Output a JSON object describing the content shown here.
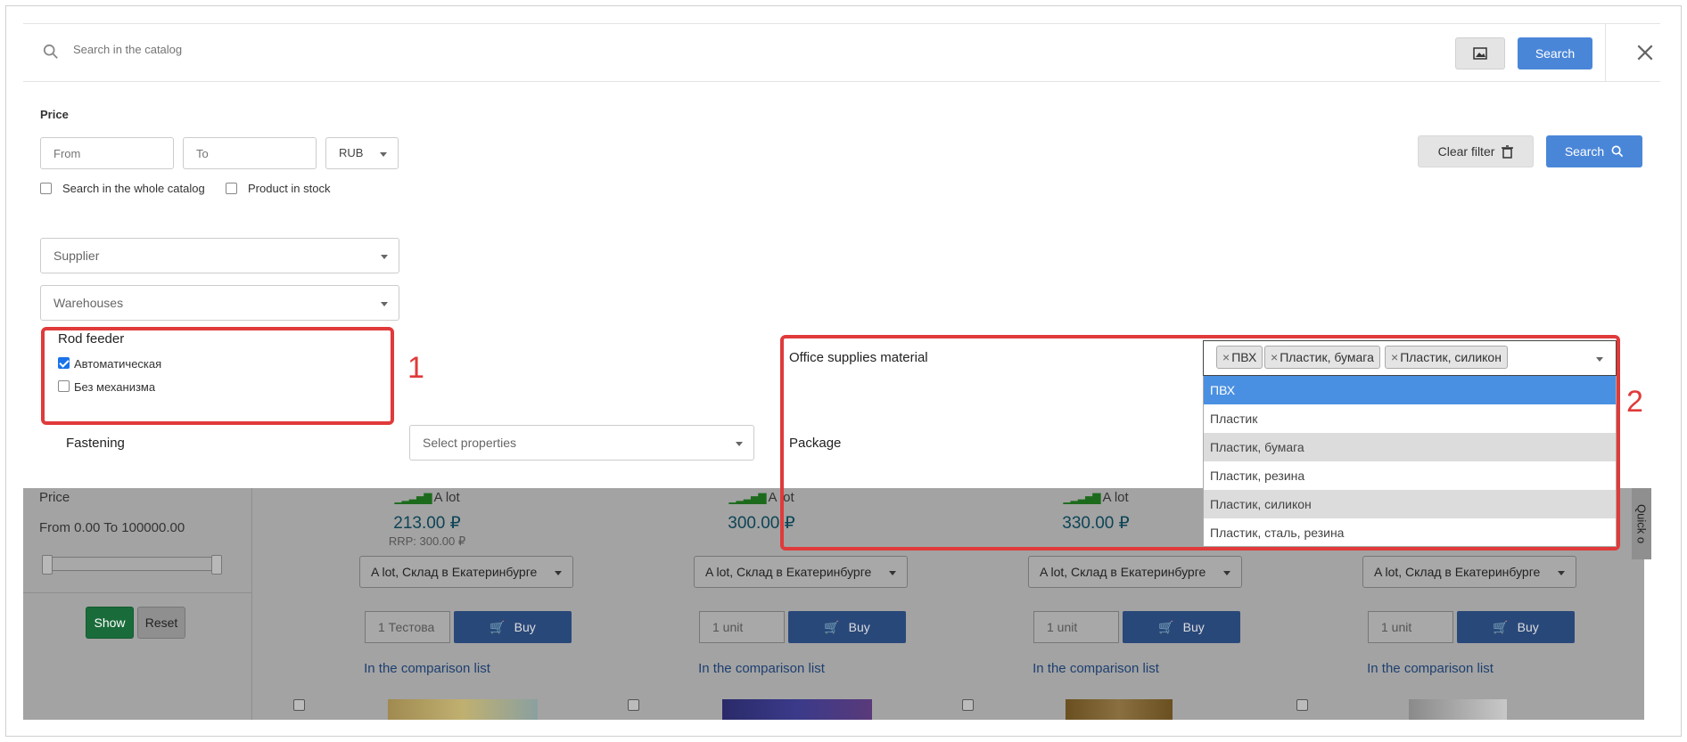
{
  "colors": {
    "primary": "#4a86d8",
    "annotation": "#e03a3a",
    "highlight_option": "#4a90e2"
  },
  "search": {
    "placeholder": "Search in the catalog",
    "button_label": "Search"
  },
  "filters": {
    "price_label": "Price",
    "from_placeholder": "From",
    "to_placeholder": "To",
    "currency": "RUB",
    "whole_catalog_label": "Search in the whole catalog",
    "whole_catalog_checked": false,
    "in_stock_label": "Product in stock",
    "in_stock_checked": false,
    "clear_label": "Clear filter",
    "search_label": "Search",
    "supplier_placeholder": "Supplier",
    "warehouses_placeholder": "Warehouses",
    "rod_feeder": {
      "title": "Rod feeder",
      "options": [
        {
          "label": "Автоматическая",
          "checked": true
        },
        {
          "label": "Без механизма",
          "checked": false
        }
      ]
    },
    "fastening_label": "Fastening",
    "fastening_placeholder": "Select properties",
    "office_material": {
      "label": "Office supplies material",
      "selected_tags": [
        "ПВХ",
        "Пластик, бумага",
        "Пластик, силикон"
      ],
      "options": [
        {
          "label": "ПВХ",
          "state": "active"
        },
        {
          "label": "Пластик",
          "state": "normal"
        },
        {
          "label": "Пластик, бумага",
          "state": "selected"
        },
        {
          "label": "Пластик, резина",
          "state": "normal"
        },
        {
          "label": "Пластик, силикон",
          "state": "selected"
        },
        {
          "label": "Пластик, сталь, резина",
          "state": "normal"
        }
      ]
    },
    "package_label": "Package"
  },
  "annotations": {
    "first": "1",
    "second": "2"
  },
  "background_catalog": {
    "sidebar": {
      "price_label": "Price",
      "range_text": "From 0.00 To 100000.00",
      "show_label": "Show",
      "reset_label": "Reset"
    },
    "products": [
      {
        "availability": "A lot",
        "price": "213.00 ₽",
        "rrp": "RRP: 300.00 ₽",
        "stock": "A lot, Склад в Екатеринбурге",
        "qty": "1 Тестова",
        "buy": "Buy",
        "compare": "In the comparison list"
      },
      {
        "availability": "A lot",
        "price": "300.00 ₽",
        "rrp": "",
        "stock": "A lot, Склад в Екатеринбурге",
        "qty": "1 unit",
        "buy": "Buy",
        "compare": "In the comparison list"
      },
      {
        "availability": "A lot",
        "price": "330.00 ₽",
        "rrp": "",
        "stock": "A lot, Склад в Екатеринбурге",
        "qty": "1 unit",
        "buy": "Buy",
        "compare": "In the comparison list"
      },
      {
        "availability": "",
        "price": "",
        "rrp": "",
        "stock": "A lot, Склад в Екатеринбурге",
        "qty": "1 unit",
        "buy": "Buy",
        "compare": "In the comparison list"
      }
    ],
    "quick_tab": "Quick o"
  }
}
